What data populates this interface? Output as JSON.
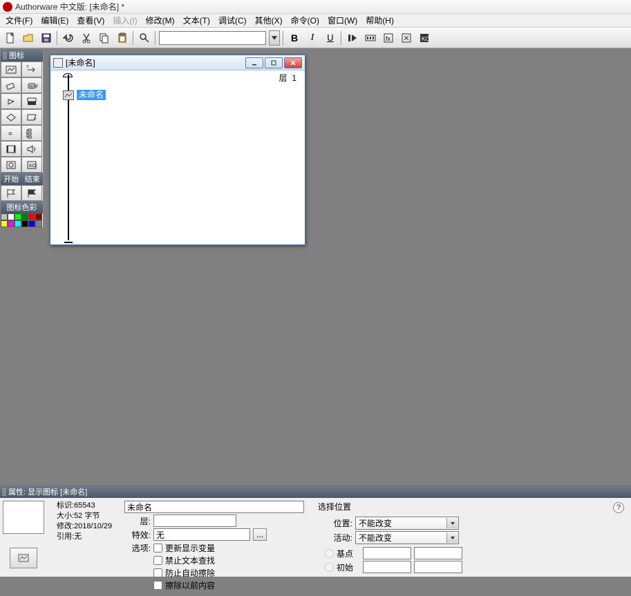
{
  "title": "Authorware 中文版: [未命名] *",
  "menu": [
    "文件(F)",
    "编辑(E)",
    "查看(V)",
    "插入(I)",
    "修改(M)",
    "文本(T)",
    "调试(C)",
    "其他(X)",
    "命令(O)",
    "窗口(W)",
    "帮助(H)"
  ],
  "menu_disabled_index": 3,
  "toolbar": {
    "bold": "B",
    "italic": "I",
    "underline": "U"
  },
  "iconpanel": {
    "header": "图标",
    "start_end": [
      "开始",
      "结束"
    ],
    "color_label": "图标色彩",
    "colors": [
      "#c0c0c0",
      "#ffffff",
      "#00ff00",
      "#008000",
      "#ff0000",
      "#800000",
      "#ffff00",
      "#ff00ff",
      "#00ffff",
      "#000000",
      "#0000ff",
      "#808080"
    ]
  },
  "flow": {
    "title": "[未命名]",
    "layer_label": "层",
    "layer_value": "1",
    "node_label": "未命名"
  },
  "props": {
    "header": "属性: 显示图标 [未命名]",
    "info": {
      "id_label": "标识:",
      "id": "65543",
      "size_label": "大小:",
      "size": "52 字节",
      "mod_label": "修改:",
      "mod": "2018/10/29",
      "ref_label": "引用:",
      "ref": "无"
    },
    "name": "未命名",
    "layer_label": "层:",
    "effect_label": "特效:",
    "effect_value": "无",
    "options_label": "选项:",
    "options": [
      "更新显示变量",
      "禁止文本查找",
      "防止自动擦除",
      "擦除以前内容"
    ],
    "select_pos_label": "选择位置",
    "pos_label": "位置:",
    "pos_value": "不能改变",
    "active_label": "活动:",
    "active_value": "不能改变",
    "base_label": "基点",
    "init_label": "初始"
  }
}
